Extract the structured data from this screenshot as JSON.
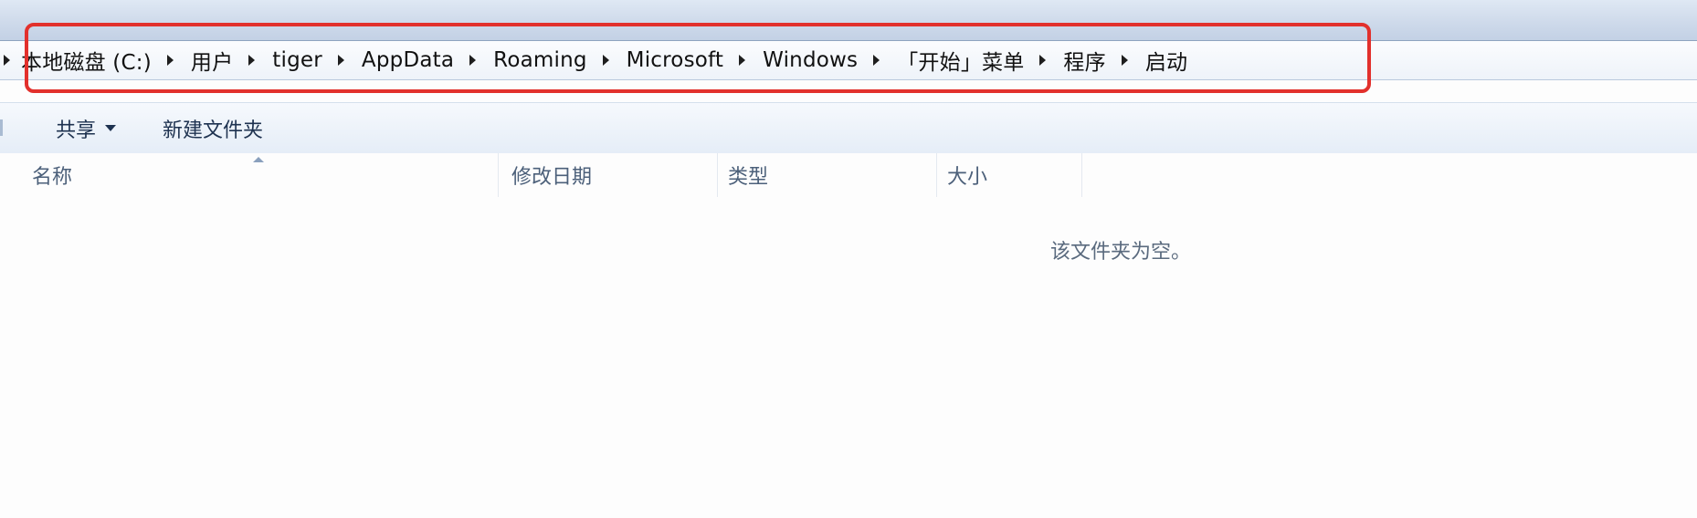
{
  "breadcrumb": {
    "items": [
      "本地磁盘 (C:)",
      "用户",
      "tiger",
      "AppData",
      "Roaming",
      "Microsoft",
      "Windows",
      "「开始」菜单",
      "程序",
      "启动"
    ]
  },
  "toolbar": {
    "share_label": "共享",
    "new_folder_label": "新建文件夹"
  },
  "columns": {
    "name": "名称",
    "date_modified": "修改日期",
    "type": "类型",
    "size": "大小"
  },
  "content": {
    "empty_message": "该文件夹为空。"
  },
  "colors": {
    "highlight": "#e2302c"
  }
}
